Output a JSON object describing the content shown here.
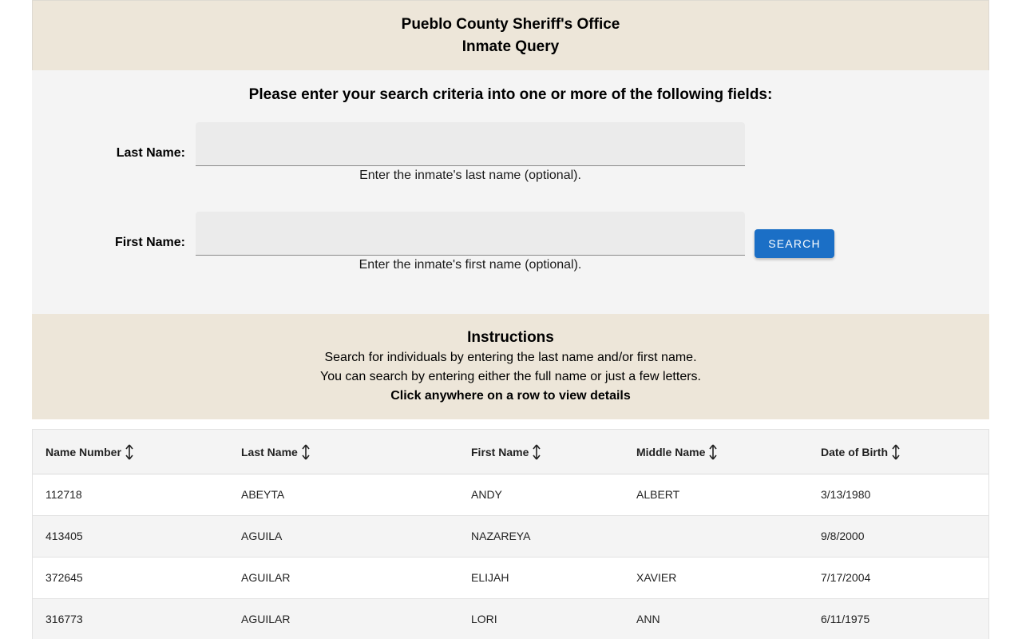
{
  "header": {
    "title": "Pueblo County Sheriff's Office",
    "subtitle": "Inmate Query"
  },
  "search": {
    "prompt": "Please enter your search criteria into one or more of the following fields:",
    "last_name_label": "Last Name:",
    "last_name_value": "",
    "last_name_help": "Enter the inmate's last name (optional).",
    "first_name_label": "First Name:",
    "first_name_value": "",
    "first_name_help": "Enter the inmate's first name (optional).",
    "button_label": "SEARCH"
  },
  "instructions": {
    "title": "Instructions",
    "line1": "Search for individuals by entering the last name and/or first name.",
    "line2": "You can search by entering either the full name or just a few letters.",
    "line3": "Click anywhere on a row to view details"
  },
  "table": {
    "columns": [
      "Name Number",
      "Last Name",
      "First Name",
      "Middle Name",
      "Date of Birth"
    ],
    "rows": [
      [
        "112718",
        "ABEYTA",
        "ANDY",
        "ALBERT",
        "3/13/1980"
      ],
      [
        "413405",
        "AGUILA",
        "NAZAREYA",
        "",
        "9/8/2000"
      ],
      [
        "372645",
        "AGUILAR",
        "ELIJAH",
        "XAVIER",
        "7/17/2004"
      ],
      [
        "316773",
        "AGUILAR",
        "LORI",
        "ANN",
        "6/11/1975"
      ]
    ]
  },
  "colors": {
    "header_bg": "#ede6d9",
    "form_bg": "#f4f4f4",
    "button": "#1b6fc6"
  },
  "icons": {
    "sort": "sort-arrows-icon"
  }
}
